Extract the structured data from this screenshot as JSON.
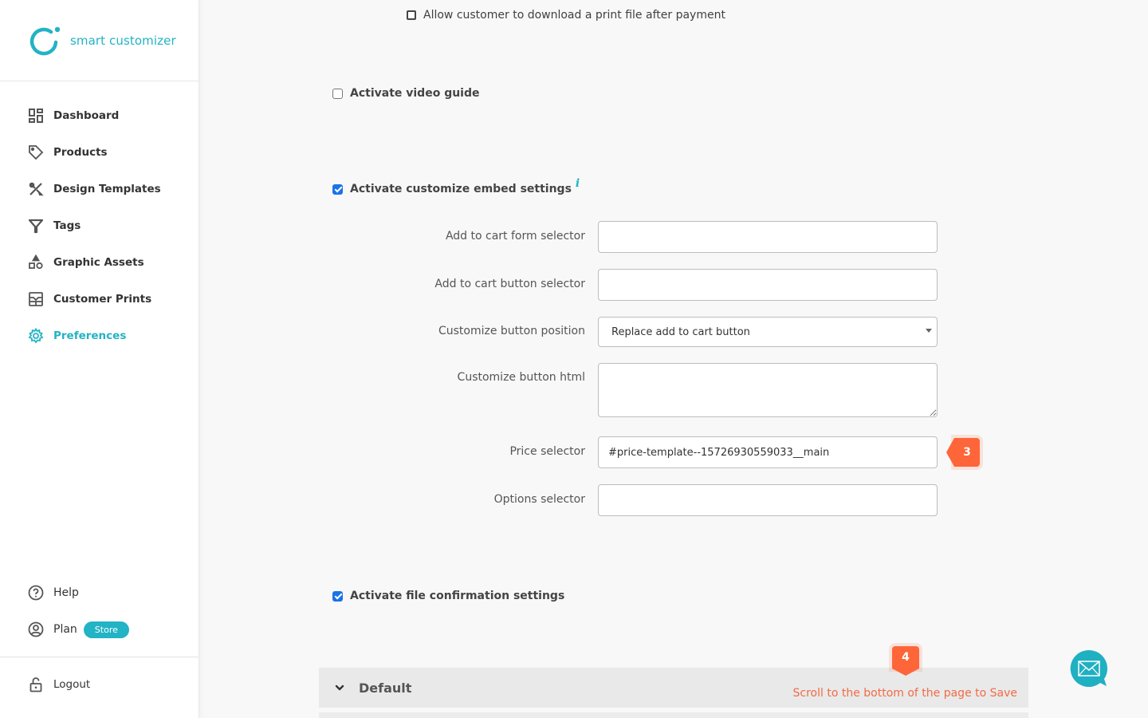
{
  "brand": {
    "name": "smart customizer",
    "color": "#22b3c5"
  },
  "sidebar": {
    "items": [
      {
        "label": "Dashboard",
        "icon": "dashboard-icon",
        "active": false
      },
      {
        "label": "Products",
        "icon": "tag-icon",
        "active": false
      },
      {
        "label": "Design Templates",
        "icon": "design-tools-icon",
        "active": false
      },
      {
        "label": "Tags",
        "icon": "filter-icon",
        "active": false
      },
      {
        "label": "Graphic Assets",
        "icon": "shapes-icon",
        "active": false
      },
      {
        "label": "Customer Prints",
        "icon": "prints-icon",
        "active": false
      },
      {
        "label": "Preferences",
        "icon": "gear-icon",
        "active": true
      }
    ],
    "bottom": {
      "help": "Help",
      "plan": "Plan",
      "plan_badge": "Store",
      "logout": "Logout"
    }
  },
  "settings": {
    "allow_download": {
      "label": "Allow customer to download a print file after payment",
      "checked": false
    },
    "video_guide": {
      "label": "Activate video guide",
      "checked": false
    },
    "embed_settings": {
      "label": "Activate customize embed settings",
      "checked": true,
      "info_glyph": "i"
    },
    "fields": {
      "add_to_cart_form": {
        "label": "Add to cart form selector",
        "value": ""
      },
      "add_to_cart_button": {
        "label": "Add to cart button selector",
        "value": ""
      },
      "button_position": {
        "label": "Customize button position",
        "value": "Replace add to cart button"
      },
      "button_html": {
        "label": "Customize button html",
        "value": ""
      },
      "price_selector": {
        "label": "Price selector",
        "value": "#price-template--15726930559033__main"
      },
      "options_selector": {
        "label": "Options selector",
        "value": ""
      }
    },
    "file_confirmation": {
      "label": "Activate file confirmation settings",
      "checked": true
    }
  },
  "steps": {
    "step3": "3",
    "step4": "4"
  },
  "accordion": {
    "title": "Default",
    "save_hint": "Scroll to the bottom of the page to Save"
  },
  "colors": {
    "accent": "#22b3c5",
    "step_marker": "#fe6539",
    "checkbox": "#1a73e8"
  }
}
